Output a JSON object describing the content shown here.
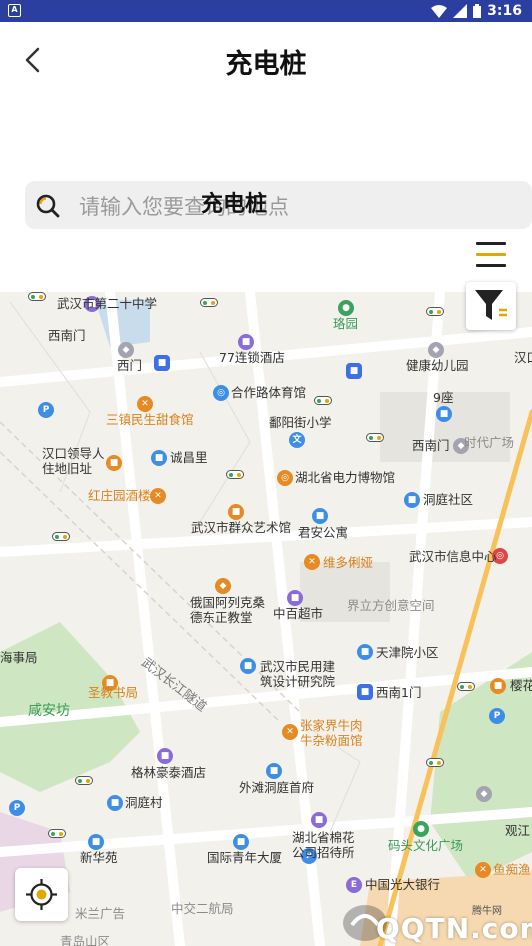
{
  "status_bar": {
    "time": "3:16",
    "notification_badge": "A"
  },
  "header": {
    "title": "充电桩",
    "back_icon": "chevron-left-icon"
  },
  "search": {
    "placeholder": "请输入您要查询的地点",
    "overlay_text": "充电桩"
  },
  "controls": {
    "list_icon": "list-menu-icon",
    "filter_icon": "filter-icon",
    "locate_icon": "locate-icon"
  },
  "colors": {
    "status_bar": "#2b3fa0",
    "accent_orange": "#e68a23",
    "map_background": "#f3f1ec",
    "poi_blue": "#3d8ee6"
  },
  "map": {
    "pois": [
      "武汉市第二十中学",
      "珞园",
      "汉口",
      "西南门",
      "77连锁酒店",
      "健康幼儿园",
      "西门",
      "三镇民生甜食馆",
      "合作路体育馆",
      "9座",
      "鄱阳街小学",
      "西南门",
      "时代广场",
      "汉口领导人住地旧址",
      "诚昌里",
      "湖北省电力博物馆",
      "洞庭社区",
      "红庄园酒楼",
      "武汉市群众艺术馆",
      "君安公寓",
      "武汉市信息中心",
      "维多俐娅",
      "俄国阿列克桑德东正教堂",
      "中百超市",
      "界立方创意空间",
      "天津院小区",
      "海事局",
      "武汉市民用建筑设计研究院",
      "西南1门",
      "樱花",
      "咸安坊",
      "圣教书局",
      "张家界牛肉牛杂粉面馆",
      "格林豪泰酒店",
      "外滩洞庭首府",
      "洞庭村",
      "湖北省棉花公司招待所",
      "观江",
      "码头文化广场",
      "新华苑",
      "国际青年大厦",
      "鱼痴渔",
      "中国光大银行",
      "米兰广告",
      "中交二航局",
      "青岛山区"
    ],
    "roads": [
      "武汉长江隧道"
    ]
  },
  "watermark": {
    "site": "腾牛网",
    "text": "QQTN.com"
  }
}
